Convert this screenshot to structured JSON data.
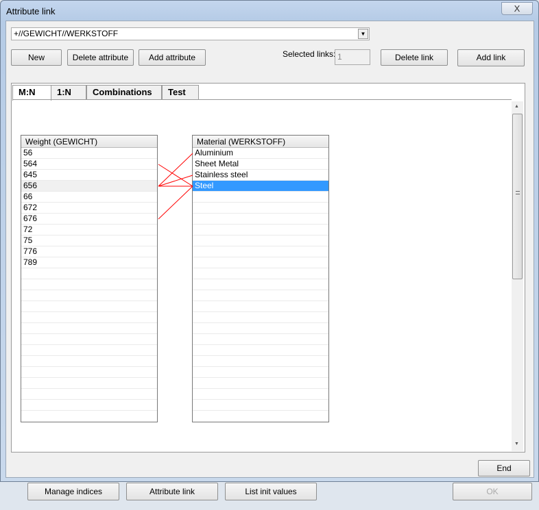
{
  "window": {
    "title": "Attribute link",
    "close_label": "X"
  },
  "combo": {
    "value": "+//GEWICHT//WERKSTOFF"
  },
  "toolbar": {
    "new": "New",
    "delete_attribute": "Delete attribute",
    "add_attribute": "Add attribute",
    "selected_links_label": "Selected links:",
    "selected_links_value": "1",
    "delete_link": "Delete link",
    "add_link": "Add link"
  },
  "tabs": [
    "M:N",
    "1:N",
    "Combinations",
    "Test"
  ],
  "left_list": {
    "header": "Weight (GEWICHT)",
    "items": [
      "56",
      "564",
      "645",
      "656",
      "66",
      "672",
      "676",
      "72",
      "75",
      "776",
      "789"
    ],
    "highlighted": 3
  },
  "right_list": {
    "header": "Material (WERKSTOFF)",
    "items": [
      "Aluminium",
      "Sheet Metal",
      "Stainless steel",
      "Steel"
    ],
    "selected": 3
  },
  "links": [
    [
      1,
      3
    ],
    [
      3,
      0
    ],
    [
      3,
      2
    ],
    [
      3,
      3
    ],
    [
      6,
      3
    ]
  ],
  "link_color": "#ff0000",
  "end_button": "End",
  "background_buttons": [
    "Manage indices",
    "Attribute link",
    "List init values",
    "OK"
  ]
}
